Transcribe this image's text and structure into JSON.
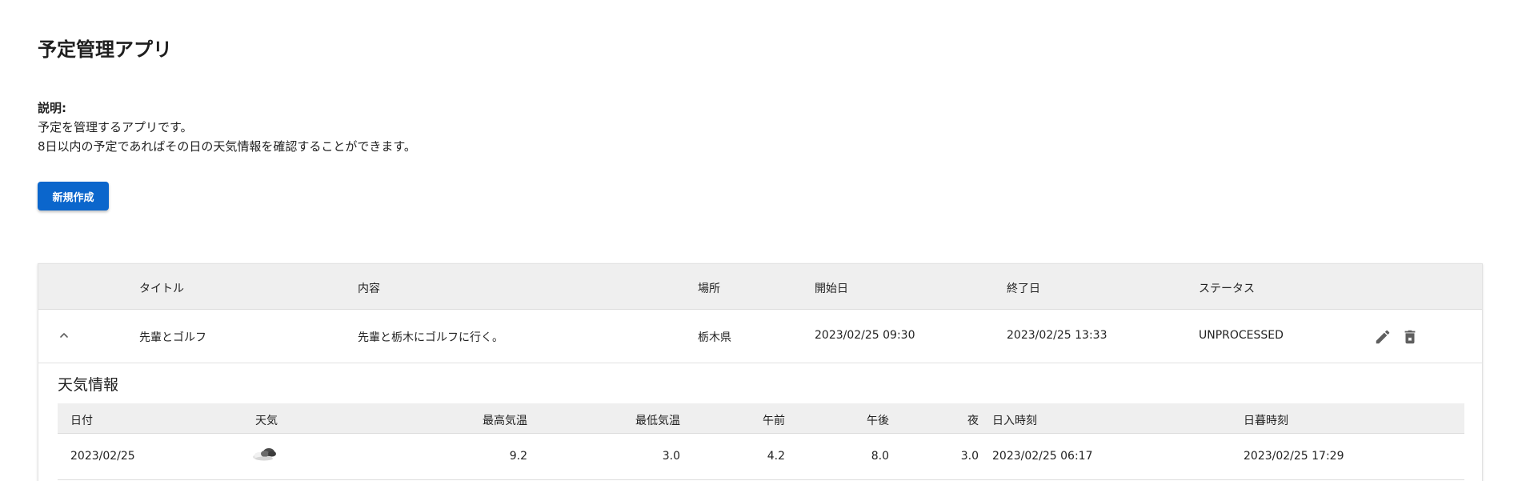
{
  "app": {
    "title": "予定管理アプリ"
  },
  "description": {
    "label": "説明:",
    "lines": [
      "予定を管理するアプリです。",
      "8日以内の予定であればその日の天気情報を確認することができます。"
    ]
  },
  "actions": {
    "create_label": "新規作成"
  },
  "schedule_table": {
    "headers": [
      "タイトル",
      "内容",
      "場所",
      "開始日",
      "終了日",
      "ステータス"
    ],
    "rows": [
      {
        "title": "先輩とゴルフ",
        "content": "先輩と栃木にゴルフに行く。",
        "place": "栃木県",
        "start": "2023/02/25 09:30",
        "end": "2023/02/25 13:33",
        "status": "UNPROCESSED"
      }
    ]
  },
  "weather": {
    "title": "天気情報",
    "headers": [
      "日付",
      "天気",
      "最高気温",
      "最低気温",
      "午前",
      "午後",
      "夜",
      "日入時刻",
      "日暮時刻"
    ],
    "rows": [
      {
        "date": "2023/02/25",
        "weather_icon": "cloud-icon",
        "max_temp": "9.2",
        "min_temp": "3.0",
        "morning": "4.2",
        "afternoon": "8.0",
        "night": "3.0",
        "sunrise": "2023/02/25 06:17",
        "sunset": "2023/02/25 17:29"
      }
    ]
  },
  "colors": {
    "primary": "#0b66cc",
    "header_bg": "#efefef",
    "icon": "#5f5f5f"
  }
}
